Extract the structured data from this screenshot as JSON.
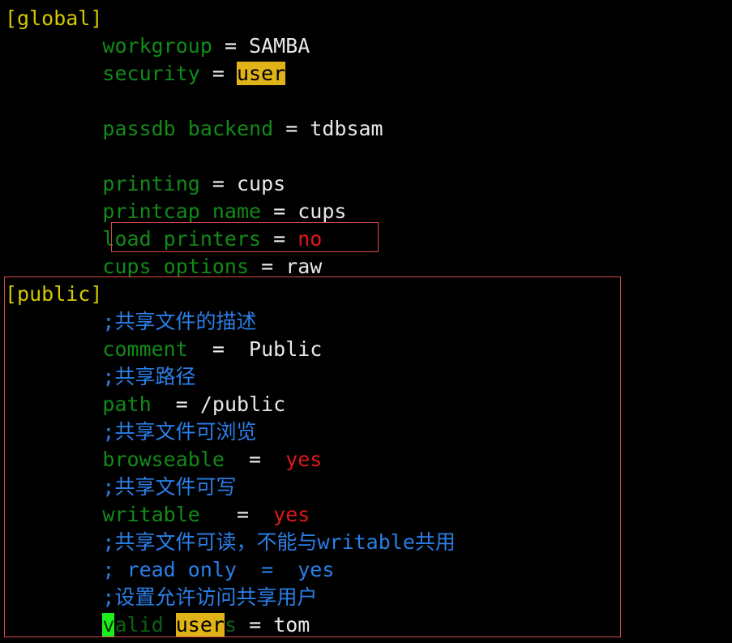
{
  "terminal": {
    "background": "#000000",
    "font_size_px": 25,
    "line_height_px": 34,
    "colors": {
      "section_header": "#d4c800",
      "config_key": "#128a18",
      "plain_value": "#e8e8e8",
      "boolean_value": "#e01818",
      "comment": "#2a7fe8",
      "search_highlight_bg": "#e0b419",
      "search_highlight_fg": "#000000",
      "cursor_bg": "#1cf01c",
      "annotation_box_border": "#d94a4a"
    }
  },
  "file": {
    "title": "smb.conf",
    "lines": [
      {
        "id": "line-global-section",
        "kind": "section",
        "indent": 0,
        "spans": [
          {
            "text": "[global]",
            "style": "section"
          }
        ]
      },
      {
        "id": "line-workgroup",
        "kind": "setting",
        "indent": 8,
        "spans": [
          {
            "text": "workgroup",
            "style": "key"
          },
          {
            "text": " = ",
            "style": "eq"
          },
          {
            "text": "SAMBA",
            "style": "value"
          }
        ]
      },
      {
        "id": "line-security",
        "kind": "setting",
        "indent": 8,
        "spans": [
          {
            "text": "security",
            "style": "key"
          },
          {
            "text": " = ",
            "style": "eq"
          },
          {
            "text": "user",
            "style": "search-highlight"
          }
        ]
      },
      {
        "id": "line-blank-1",
        "kind": "blank",
        "indent": 0,
        "spans": [
          {
            "text": " ",
            "style": "value"
          }
        ]
      },
      {
        "id": "line-passdb-backend",
        "kind": "setting",
        "indent": 8,
        "spans": [
          {
            "text": "passdb backend",
            "style": "key"
          },
          {
            "text": " = ",
            "style": "eq"
          },
          {
            "text": "tdbsam",
            "style": "value"
          }
        ]
      },
      {
        "id": "line-blank-2",
        "kind": "blank",
        "indent": 0,
        "spans": [
          {
            "text": " ",
            "style": "value"
          }
        ]
      },
      {
        "id": "line-printing",
        "kind": "setting",
        "indent": 8,
        "spans": [
          {
            "text": "printing",
            "style": "key"
          },
          {
            "text": " = ",
            "style": "eq"
          },
          {
            "text": "cups",
            "style": "value"
          }
        ]
      },
      {
        "id": "line-printcap-name",
        "kind": "setting",
        "indent": 8,
        "spans": [
          {
            "text": "printcap name",
            "style": "key"
          },
          {
            "text": " = ",
            "style": "eq"
          },
          {
            "text": "cups",
            "style": "value"
          }
        ]
      },
      {
        "id": "line-load-printers",
        "kind": "setting",
        "indent": 8,
        "spans": [
          {
            "text": "load printers",
            "style": "key"
          },
          {
            "text": " = ",
            "style": "eq"
          },
          {
            "text": "no",
            "style": "red"
          }
        ]
      },
      {
        "id": "line-cups-options",
        "kind": "setting",
        "indent": 8,
        "spans": [
          {
            "text": "cups options",
            "style": "key"
          },
          {
            "text": " = ",
            "style": "eq"
          },
          {
            "text": "raw",
            "style": "value"
          }
        ]
      },
      {
        "id": "line-public-section",
        "kind": "section",
        "indent": 0,
        "spans": [
          {
            "text": "[public]",
            "style": "section"
          }
        ]
      },
      {
        "id": "line-comment-description",
        "kind": "comment",
        "indent": 8,
        "spans": [
          {
            "text": ";共享文件的描述",
            "style": "comment"
          }
        ]
      },
      {
        "id": "line-comment-setting",
        "kind": "setting",
        "indent": 8,
        "spans": [
          {
            "text": "comment",
            "style": "key"
          },
          {
            "text": "  =  ",
            "style": "eq"
          },
          {
            "text": "Public",
            "style": "value"
          }
        ]
      },
      {
        "id": "line-comment-path",
        "kind": "comment",
        "indent": 8,
        "spans": [
          {
            "text": ";共享路径",
            "style": "comment"
          }
        ]
      },
      {
        "id": "line-path",
        "kind": "setting",
        "indent": 8,
        "spans": [
          {
            "text": "path",
            "style": "key"
          },
          {
            "text": "  = ",
            "style": "eq"
          },
          {
            "text": "/public",
            "style": "value"
          }
        ]
      },
      {
        "id": "line-comment-browseable",
        "kind": "comment",
        "indent": 8,
        "spans": [
          {
            "text": ";共享文件可浏览",
            "style": "comment"
          }
        ]
      },
      {
        "id": "line-browseable",
        "kind": "setting",
        "indent": 8,
        "spans": [
          {
            "text": "browseable",
            "style": "key"
          },
          {
            "text": "  =  ",
            "style": "eq"
          },
          {
            "text": "yes",
            "style": "red"
          }
        ]
      },
      {
        "id": "line-comment-writable",
        "kind": "comment",
        "indent": 8,
        "spans": [
          {
            "text": ";共享文件可写",
            "style": "comment"
          }
        ]
      },
      {
        "id": "line-writable",
        "kind": "setting",
        "indent": 8,
        "spans": [
          {
            "text": "writable",
            "style": "key"
          },
          {
            "text": "   =  ",
            "style": "eq"
          },
          {
            "text": "yes",
            "style": "red"
          }
        ]
      },
      {
        "id": "line-comment-readonly-note",
        "kind": "comment",
        "indent": 8,
        "spans": [
          {
            "text": ";共享文件可读，不能与writable共用",
            "style": "comment"
          }
        ]
      },
      {
        "id": "line-read-only",
        "kind": "comment",
        "indent": 8,
        "spans": [
          {
            "text": "; read only  =  yes",
            "style": "comment"
          }
        ]
      },
      {
        "id": "line-comment-valid-users",
        "kind": "comment",
        "indent": 8,
        "spans": [
          {
            "text": ";设置允许访问共享用户",
            "style": "comment"
          }
        ]
      },
      {
        "id": "line-valid-users",
        "kind": "setting",
        "indent": 8,
        "spans": [
          {
            "text": "v",
            "style": "cursor"
          },
          {
            "text": "alid ",
            "style": "dim"
          },
          {
            "text": "user",
            "style": "search-highlight"
          },
          {
            "text": "s",
            "style": "dim"
          },
          {
            "text": " = ",
            "style": "eq"
          },
          {
            "text": "tom",
            "style": "value"
          }
        ]
      }
    ]
  },
  "annotations": [
    {
      "id": "box-load-printers",
      "label": "load-printers-highlight-box",
      "target_text": "load printers = no",
      "color": "#d94a4a"
    },
    {
      "id": "box-public-section",
      "label": "public-section-highlight-box",
      "target_text": "[public]",
      "color": "#d94a4a"
    }
  ],
  "cursor": {
    "line": "line-valid-users",
    "character": "v",
    "column": 1
  },
  "search": {
    "term": "user",
    "match_count": 2
  }
}
